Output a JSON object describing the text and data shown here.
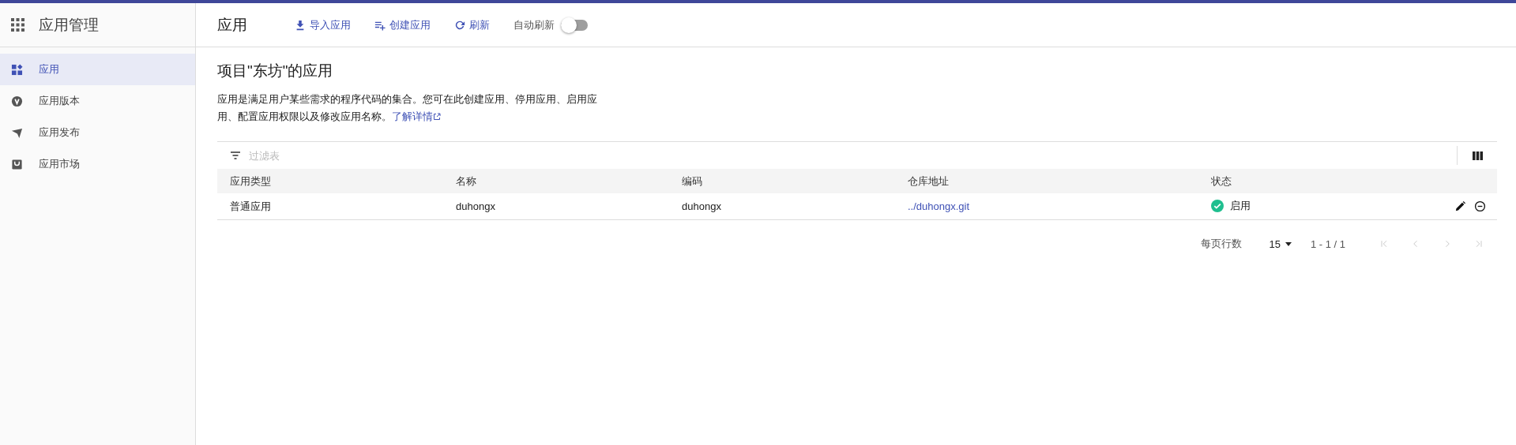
{
  "app": {
    "title": "应用管理"
  },
  "sidebar": {
    "items": [
      {
        "label": "应用",
        "selected": true
      },
      {
        "label": "应用版本",
        "selected": false
      },
      {
        "label": "应用发布",
        "selected": false
      },
      {
        "label": "应用市场",
        "selected": false
      }
    ]
  },
  "toolbar": {
    "title": "应用",
    "actions": [
      {
        "label": "导入应用"
      },
      {
        "label": "创建应用"
      },
      {
        "label": "刷新"
      }
    ],
    "auto_refresh": {
      "label": "自动刷新",
      "on": false
    }
  },
  "page": {
    "heading": "项目\"东坊\"的应用",
    "description": "应用是满足用户某些需求的程序代码的集合。您可在此创建应用、停用应用、启用应用、配置应用权限以及修改应用名称。",
    "learn_more": "了解详情"
  },
  "table": {
    "filter": {
      "placeholder": "过滤表"
    },
    "columns": [
      "应用类型",
      "名称",
      "编码",
      "仓库地址",
      "状态"
    ],
    "rows": [
      {
        "type": "普通应用",
        "name": "duhongx",
        "code": "duhongx",
        "repo": "../duhongx.git",
        "status": {
          "label": "启用",
          "enabled": true
        }
      }
    ]
  },
  "pagination": {
    "rows_per_page_label": "每页行数",
    "rows_per_page": "15",
    "range": "1 - 1 / 1",
    "buttons": [
      {
        "kind": "first",
        "disabled": true
      },
      {
        "kind": "prev",
        "disabled": true
      },
      {
        "kind": "next",
        "disabled": true
      },
      {
        "kind": "last",
        "disabled": true
      }
    ]
  }
}
